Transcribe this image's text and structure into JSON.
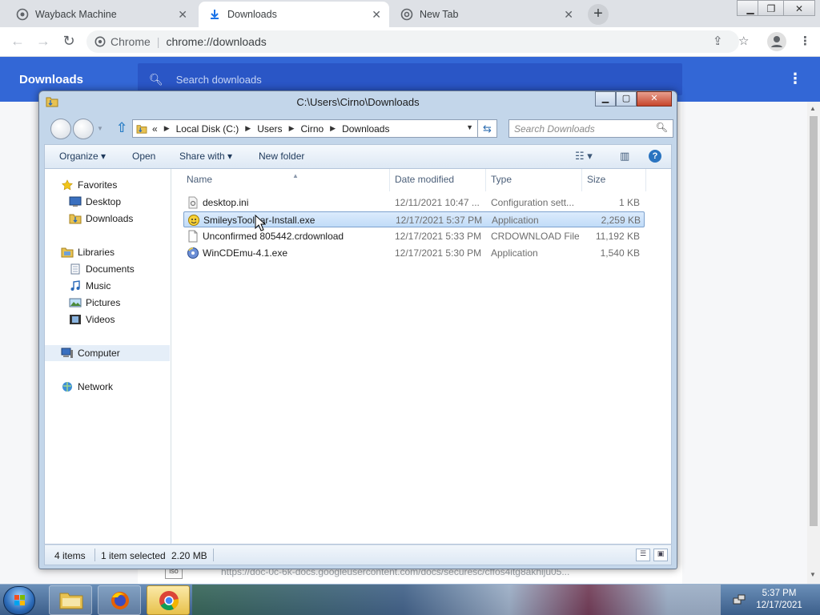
{
  "browser": {
    "tabs": [
      {
        "label": "Wayback Machine",
        "active": false
      },
      {
        "label": "Downloads",
        "active": true
      },
      {
        "label": "New Tab",
        "active": false
      }
    ],
    "omnibox": {
      "chip": "Chrome",
      "url": "chrome://downloads"
    },
    "page_title": "Downloads",
    "search_placeholder": "Search downloads",
    "background_url": "https://doc-0c-6k-docs.googleusercontent.com/docs/securesc/cffos4itg8akhiju05...",
    "background_file_badge": "iso"
  },
  "explorer": {
    "title": "C:\\Users\\Cirno\\Downloads",
    "breadcrumb": {
      "overflow": "«",
      "items": [
        "Local Disk (C:)",
        "Users",
        "Cirno",
        "Downloads"
      ]
    },
    "search_placeholder": "Search Downloads",
    "commands": {
      "organize": "Organize",
      "open": "Open",
      "share_with": "Share with",
      "new_folder": "New folder"
    },
    "nav": {
      "favorites": {
        "label": "Favorites",
        "items": [
          "Desktop",
          "Downloads"
        ]
      },
      "libraries": {
        "label": "Libraries",
        "items": [
          "Documents",
          "Music",
          "Pictures",
          "Videos"
        ]
      },
      "computer": "Computer",
      "network": "Network"
    },
    "columns": {
      "name": "Name",
      "date": "Date modified",
      "type": "Type",
      "size": "Size"
    },
    "files": [
      {
        "name": "desktop.ini",
        "date": "12/11/2021 10:47 ...",
        "type": "Configuration sett...",
        "size": "1 KB",
        "selected": false
      },
      {
        "name": "SmileysToolbar-Install.exe",
        "date": "12/17/2021 5:37 PM",
        "type": "Application",
        "size": "2,259 KB",
        "selected": true
      },
      {
        "name": "Unconfirmed 805442.crdownload",
        "date": "12/17/2021 5:33 PM",
        "type": "CRDOWNLOAD File",
        "size": "11,192 KB",
        "selected": false
      },
      {
        "name": "WinCDEmu-4.1.exe",
        "date": "12/17/2021 5:30 PM",
        "type": "Application",
        "size": "1,540 KB",
        "selected": false
      }
    ],
    "status": {
      "count": "4 items",
      "selected": "1 item selected",
      "size": "2.20 MB"
    }
  },
  "taskbar": {
    "time": "5:37 PM",
    "date": "12/17/2021"
  },
  "colors": {
    "chrome_header": "#3367d6",
    "selection_fill": "#c1dcf8",
    "selection_border": "#7da2ce"
  }
}
